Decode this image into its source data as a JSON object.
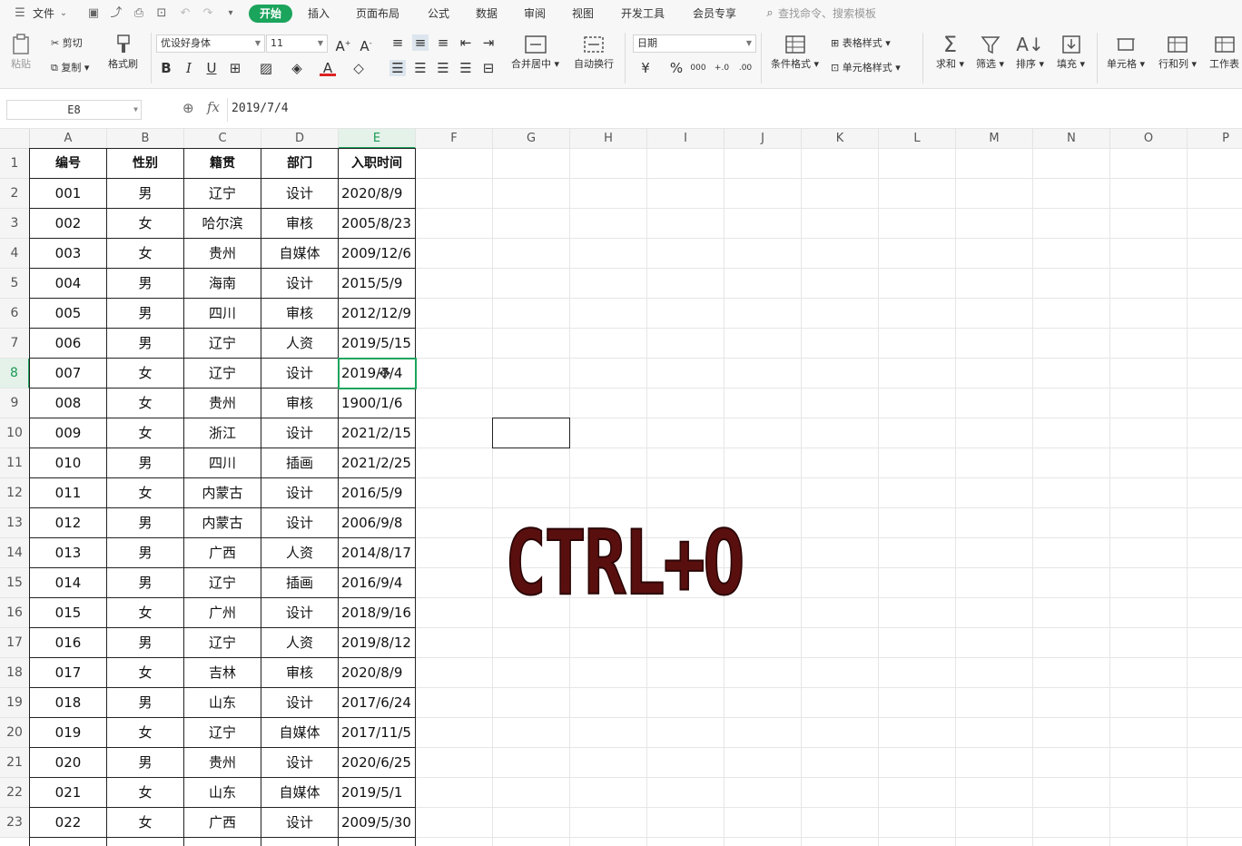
{
  "menubar": {
    "menu_icon": "hamburger-icon",
    "file": "文件",
    "tabs": [
      "开始",
      "插入",
      "页面布局",
      "公式",
      "数据",
      "审阅",
      "视图",
      "开发工具",
      "会员专享"
    ],
    "active_tab": "开始",
    "search_placeholder": "查找命令、搜索模板"
  },
  "ribbon": {
    "paste": "粘贴",
    "cut": "剪切",
    "copy": "复制",
    "format_painter": "格式刷",
    "font_name": "优设好身体",
    "font_size": "11",
    "merge_center": "合并居中",
    "wrap_text": "自动换行",
    "number_format": "日期",
    "conditional_format": "条件格式",
    "table_style": "表格样式",
    "cell_style": "单元格样式",
    "sum": "求和",
    "filter": "筛选",
    "sort": "排序",
    "fill": "填充",
    "cells": "单元格",
    "rows_cols": "行和列",
    "worksheet": "工作表",
    "currency": "¥",
    "percent": "%",
    "thousands": "000",
    "inc_decimal": "+.0",
    "dec_decimal": ".00"
  },
  "formula_bar": {
    "name_box": "E8",
    "fx": "fx",
    "value": "2019/7/4"
  },
  "sheet": {
    "columns": [
      "A",
      "B",
      "C",
      "D",
      "E",
      "F",
      "G",
      "H",
      "I",
      "J",
      "K",
      "L",
      "M",
      "N",
      "O",
      "P"
    ],
    "rows": [
      "1",
      "2",
      "3",
      "4",
      "5",
      "6",
      "7",
      "8",
      "9",
      "10",
      "11",
      "12",
      "13",
      "14",
      "15",
      "16",
      "17",
      "18",
      "19",
      "20",
      "21",
      "22",
      "23"
    ],
    "active_column": "E",
    "active_row": "8",
    "headers": [
      "编号",
      "性别",
      "籍贯",
      "部门",
      "入职时间"
    ],
    "data": [
      [
        "001",
        "男",
        "辽宁",
        "设计",
        "2020/8/9"
      ],
      [
        "002",
        "女",
        "哈尔滨",
        "审核",
        "2005/8/23"
      ],
      [
        "003",
        "女",
        "贵州",
        "自媒体",
        "2009/12/6"
      ],
      [
        "004",
        "男",
        "海南",
        "设计",
        "2015/5/9"
      ],
      [
        "005",
        "男",
        "四川",
        "审核",
        "2012/12/9"
      ],
      [
        "006",
        "男",
        "辽宁",
        "人资",
        "2019/5/15"
      ],
      [
        "007",
        "女",
        "辽宁",
        "设计",
        "2019/7/4"
      ],
      [
        "008",
        "女",
        "贵州",
        "审核",
        "1900/1/6"
      ],
      [
        "009",
        "女",
        "浙江",
        "设计",
        "2021/2/15"
      ],
      [
        "010",
        "男",
        "四川",
        "插画",
        "2021/2/25"
      ],
      [
        "011",
        "女",
        "内蒙古",
        "设计",
        "2016/5/9"
      ],
      [
        "012",
        "男",
        "内蒙古",
        "设计",
        "2006/9/8"
      ],
      [
        "013",
        "男",
        "广西",
        "人资",
        "2014/8/17"
      ],
      [
        "014",
        "男",
        "辽宁",
        "插画",
        "2016/9/4"
      ],
      [
        "015",
        "女",
        "广州",
        "设计",
        "2018/9/16"
      ],
      [
        "016",
        "男",
        "辽宁",
        "人资",
        "2019/8/12"
      ],
      [
        "017",
        "女",
        "吉林",
        "审核",
        "2020/8/9"
      ],
      [
        "018",
        "男",
        "山东",
        "设计",
        "2017/6/24"
      ],
      [
        "019",
        "女",
        "辽宁",
        "自媒体",
        "2017/11/5"
      ],
      [
        "020",
        "男",
        "贵州",
        "设计",
        "2020/6/25"
      ],
      [
        "021",
        "女",
        "山东",
        "自媒体",
        "2019/5/1"
      ],
      [
        "022",
        "女",
        "广西",
        "设计",
        "2009/5/30"
      ]
    ]
  },
  "overlay_text": "CTRL+O",
  "colors": {
    "accent": "#1ba45c",
    "overlay": "#5a0f0f"
  }
}
